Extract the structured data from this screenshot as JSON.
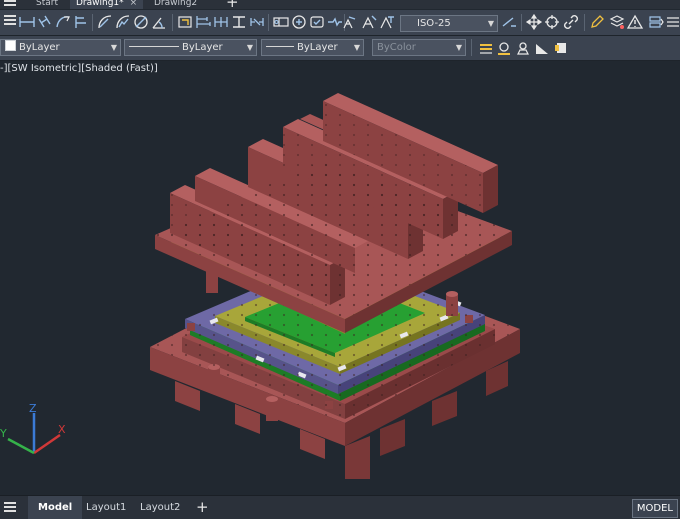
{
  "doc_tabs": [
    {
      "label": "Start"
    },
    {
      "label": "Drawing1*"
    },
    {
      "label": "Drawing2"
    }
  ],
  "close_glyph": "×",
  "new_tab_glyph": "+",
  "ribbon": {
    "dim_style": "ISO-25",
    "layer": "ByLayer",
    "linetype": "ByLayer",
    "lineweight": "ByLayer",
    "plot_style": "ByColor"
  },
  "viewport": {
    "label": "-][SW Isometric][Shaded (Fast)]"
  },
  "ucs": {
    "x": "X",
    "y": "Y",
    "z": "Z"
  },
  "layout_tabs": [
    {
      "label": "Model"
    },
    {
      "label": "Layout1"
    },
    {
      "label": "Layout2"
    }
  ],
  "status": {
    "space": "MODEL"
  },
  "colors": {
    "background": "#212830",
    "plate_red": "#9a4a4a",
    "plate_purple": "#6e69a6",
    "plate_yellow": "#a8a63a",
    "cavity_green": "#27a032",
    "ribbon": "#3b4350"
  },
  "icons": [
    "menu-icon",
    "linear-dimension-icon",
    "aligned-dimension-icon",
    "arc-length-icon",
    "ordinate-icon",
    "radius-icon",
    "jogged-icon",
    "diameter-icon",
    "angular-icon",
    "quick-dimension-icon",
    "baseline-icon",
    "continue-icon",
    "space-icon",
    "break-icon",
    "tolerance-icon",
    "center-mark-icon",
    "inspection-icon",
    "jogged-linear-icon",
    "oblique-icon",
    "text-angle-icon",
    "dim-style-icon",
    "move-icon",
    "rotate-icon",
    "link-icon",
    "edit-icon",
    "layer-icon",
    "warning-icon",
    "settings-icon",
    "layer-properties-icon",
    "layer-match-icon",
    "layer-previous-icon",
    "layer-freeze-icon",
    "layer-lock-icon"
  ]
}
